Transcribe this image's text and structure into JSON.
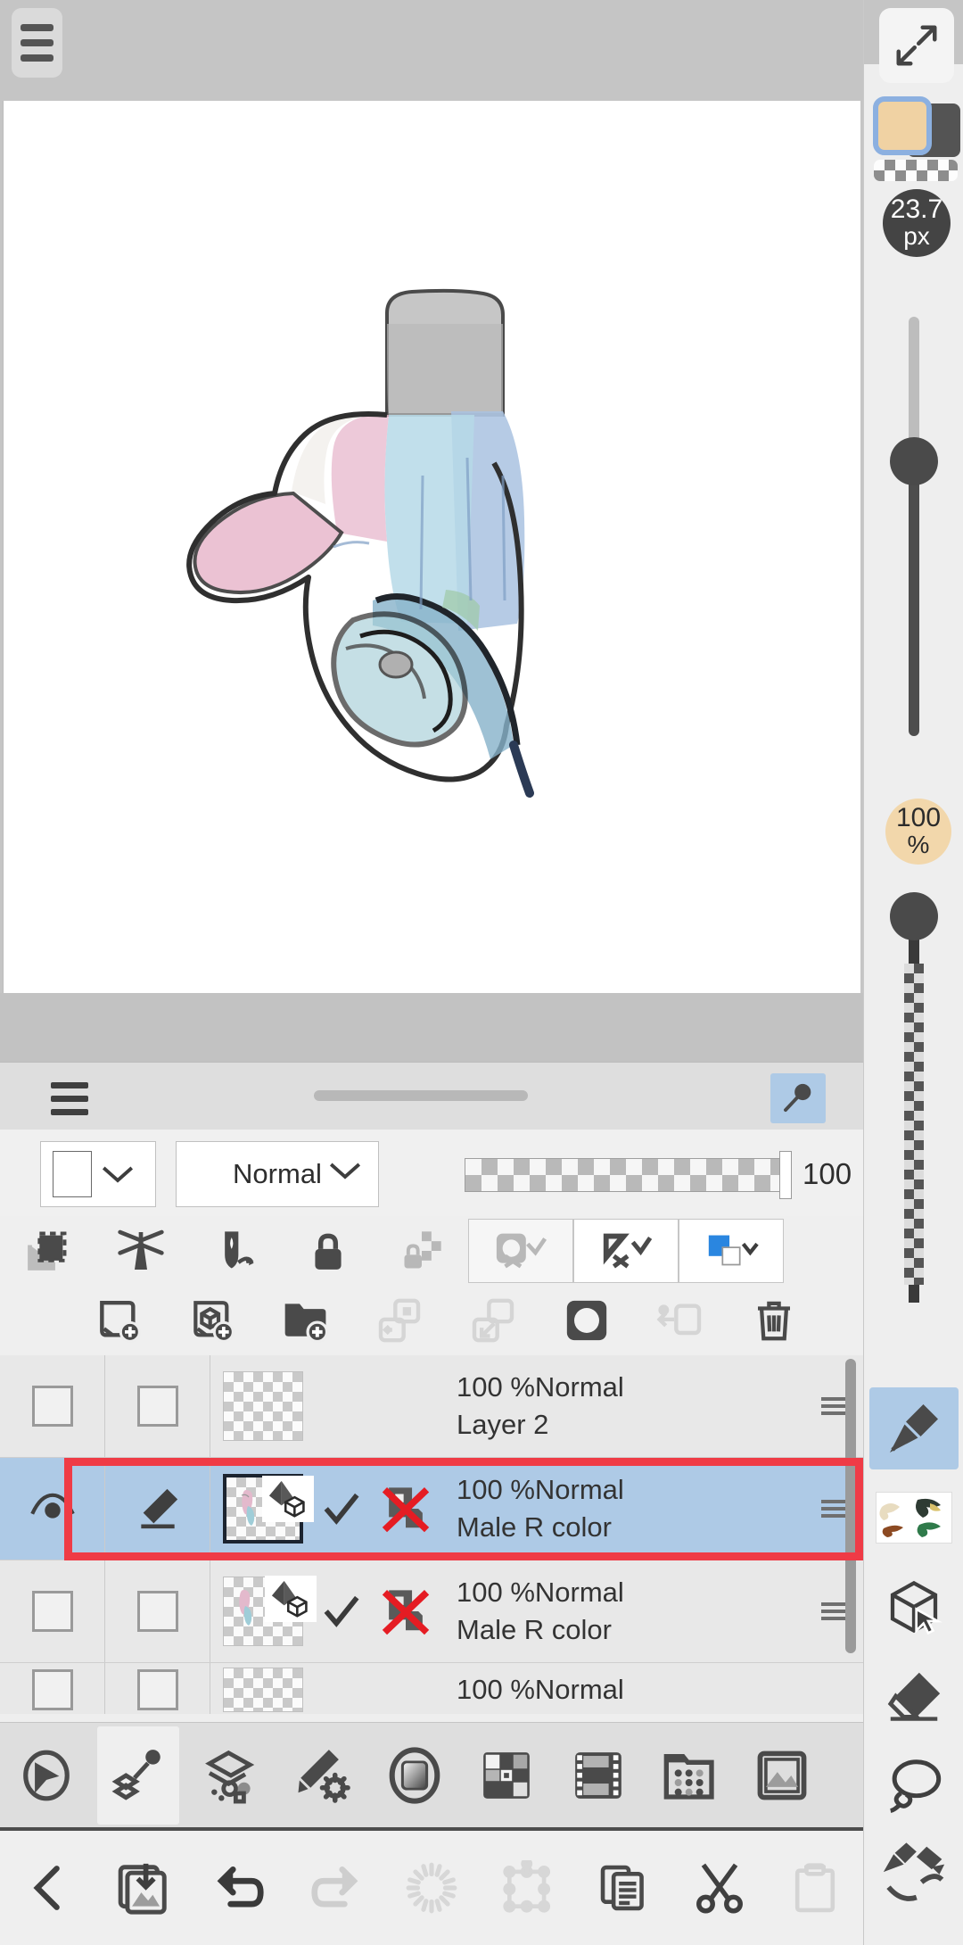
{
  "app": {
    "name": "paint-app",
    "accent_blue": "#aecae6",
    "selection_red": "#ef3b46",
    "panel_bg": "#eeeeee",
    "canvas_bg": "#ffffff"
  },
  "topbar": {
    "menu_icon": "hamburger-menu-icon"
  },
  "right_rail": {
    "expand_icon": "expand-diagonal-icon",
    "foreground_color": "#f0d2a3",
    "background_color": "#545454",
    "transparency_icon": "checkerboard-transparency-icon",
    "brush_size": {
      "value": "23.7",
      "unit": "px"
    },
    "opacity": {
      "value": "100",
      "unit": "%"
    },
    "tools": [
      {
        "name": "pen-tool",
        "label": "Pen",
        "active": true
      },
      {
        "name": "material-thumbnail",
        "label": "Material",
        "active": false
      },
      {
        "name": "3d-select-tool",
        "label": "3D Object Select",
        "active": false
      },
      {
        "name": "eraser-tool",
        "label": "Eraser",
        "active": false
      },
      {
        "name": "lasso-tool",
        "label": "Lasso",
        "active": false
      },
      {
        "name": "pen-eraser-swap-tool",
        "label": "Pen/Eraser Swap",
        "active": false
      }
    ]
  },
  "layers_panel": {
    "menu_icon": "hamburger-menu-icon",
    "drag_handle": "panel-drag-handle",
    "pin_icon": "pin-icon",
    "color_picker_value": "#ffffff",
    "blend_mode": "Normal",
    "opacity_value": "100",
    "toolbar_row1": [
      {
        "name": "clipping-mask-icon",
        "label": "Clipping",
        "state": "enabled"
      },
      {
        "name": "symmetry-ruler-icon",
        "label": "Symmetry Ruler",
        "state": "enabled"
      },
      {
        "name": "selection-source-icon",
        "label": "Selection Source",
        "state": "enabled"
      },
      {
        "name": "lock-layer-icon",
        "label": "Lock Layer",
        "state": "enabled"
      },
      {
        "name": "alpha-lock-icon",
        "label": "Alpha Lock",
        "state": "disabled"
      },
      {
        "name": "mask-none-icon",
        "label": "Layer Mask",
        "state": "disabled"
      },
      {
        "name": "ruler-none-icon",
        "label": "Ruler",
        "state": "enabled"
      },
      {
        "name": "layer-color-icon",
        "label": "Layer Color",
        "state": "enabled",
        "color": "#2a86e0"
      }
    ],
    "toolbar_row2": [
      {
        "name": "add-layer-icon",
        "label": "Add Layer",
        "state": "enabled"
      },
      {
        "name": "add-3d-layer-icon",
        "label": "Add 3D Layer",
        "state": "enabled"
      },
      {
        "name": "add-folder-icon",
        "label": "Add Folder",
        "state": "enabled"
      },
      {
        "name": "duplicate-layer-icon",
        "label": "Duplicate Layer",
        "state": "disabled"
      },
      {
        "name": "merge-down-icon",
        "label": "Merge Down",
        "state": "disabled"
      },
      {
        "name": "mask-circle-icon",
        "label": "Layer Mask",
        "state": "enabled"
      },
      {
        "name": "transfer-layer-icon",
        "label": "Transfer",
        "state": "disabled"
      },
      {
        "name": "delete-layer-icon",
        "label": "Delete Layer",
        "state": "enabled"
      }
    ],
    "layers": [
      {
        "visible": false,
        "draw_enabled": false,
        "opacity_blend": "100 %Normal",
        "name": "Layer 2",
        "selected": false,
        "has_3d": false,
        "checked": false,
        "folder_disabled": false
      },
      {
        "visible": true,
        "draw_enabled": true,
        "opacity_blend": "100 %Normal",
        "name": "Male R color",
        "selected": true,
        "has_3d": true,
        "checked": true,
        "folder_disabled": true
      },
      {
        "visible": false,
        "draw_enabled": false,
        "opacity_blend": "100 %Normal",
        "name": "Male R color",
        "selected": false,
        "has_3d": true,
        "checked": true,
        "folder_disabled": true
      },
      {
        "visible": false,
        "draw_enabled": false,
        "opacity_blend": "100 %Normal",
        "name": "",
        "selected": false,
        "has_3d": false,
        "checked": false,
        "folder_disabled": false
      }
    ]
  },
  "bottom_tools": [
    {
      "name": "selection-tool-icon",
      "label": "Select",
      "active": false
    },
    {
      "name": "layers-panel-icon",
      "label": "Layers",
      "active": true
    },
    {
      "name": "layer-options-icon",
      "label": "Layer Options",
      "active": false
    },
    {
      "name": "brush-settings-icon",
      "label": "Brush Settings",
      "active": false
    },
    {
      "name": "color-wheel-icon",
      "label": "Color",
      "active": false
    },
    {
      "name": "palette-swatches-icon",
      "label": "Palette",
      "active": false
    },
    {
      "name": "filmstrip-icon",
      "label": "Animation",
      "active": false
    },
    {
      "name": "materials-folder-icon",
      "label": "Materials",
      "active": false
    },
    {
      "name": "image-import-icon",
      "label": "Image",
      "active": false
    }
  ],
  "bottom_nav": [
    {
      "name": "back-icon",
      "label": "Back",
      "state": "enabled"
    },
    {
      "name": "save-image-icon",
      "label": "Save",
      "state": "enabled"
    },
    {
      "name": "undo-icon",
      "label": "Undo",
      "state": "enabled"
    },
    {
      "name": "redo-icon",
      "label": "Redo",
      "state": "disabled"
    },
    {
      "name": "blur-icon",
      "label": "Blur",
      "state": "disabled"
    },
    {
      "name": "transform-icon",
      "label": "Transform",
      "state": "disabled"
    },
    {
      "name": "copy-icon",
      "label": "Copy",
      "state": "enabled"
    },
    {
      "name": "cut-scissors-icon",
      "label": "Cut",
      "state": "enabled"
    },
    {
      "name": "paste-clipboard-icon",
      "label": "Paste",
      "state": "disabled"
    }
  ]
}
